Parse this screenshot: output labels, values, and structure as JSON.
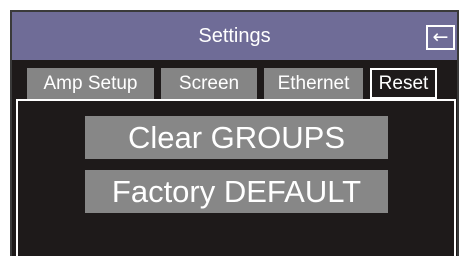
{
  "header": {
    "title": "Settings",
    "back_icon": "←"
  },
  "tabs": [
    {
      "label": "Amp Setup",
      "active": false
    },
    {
      "label": "Screen",
      "active": false
    },
    {
      "label": "Ethernet",
      "active": false
    },
    {
      "label": "Reset",
      "active": true
    }
  ],
  "reset_panel": {
    "clear_groups_label": "Clear GROUPS",
    "factory_default_label": "Factory DEFAULT"
  },
  "colors": {
    "title_bar": "#6f6c97",
    "background": "#1e1a1a",
    "tab_inactive": "#858585",
    "button": "#878787",
    "text": "#ffffff"
  }
}
